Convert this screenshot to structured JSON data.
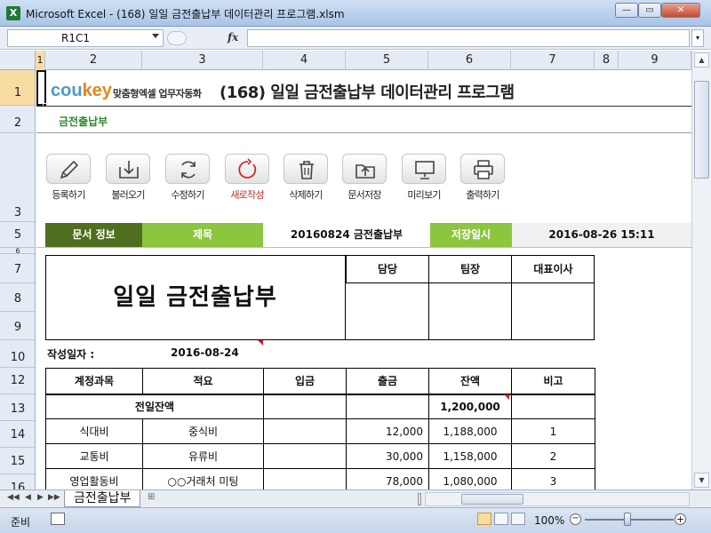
{
  "window": {
    "title": "Microsoft Excel - (168) 일일 금전출납부 데이터관리 프로그램.xlsm",
    "icon": "excel-icon",
    "min_label": "—",
    "max_label": "▭",
    "close_label": "✕"
  },
  "formula_bar": {
    "name_box": "R1C1",
    "fx_label": "fx",
    "formula": ""
  },
  "columns": [
    "1",
    "2",
    "3",
    "4",
    "5",
    "6",
    "7",
    "8",
    "9"
  ],
  "rows": [
    "1",
    "2",
    "3",
    "5",
    "6",
    "7",
    "8",
    "9",
    "10",
    "12",
    "13",
    "14",
    "15",
    "16"
  ],
  "header": {
    "logo_cou": "cou",
    "logo_key": "key",
    "logo_tagline": "맞춤형엑셀 업무자동화",
    "app_title": "(168) 일일 금전출납부 데이터관리 프로그램",
    "subtitle": "금전출납부"
  },
  "toolbar": [
    {
      "id": "register",
      "label": "등록하기",
      "icon": "pencil-icon"
    },
    {
      "id": "load",
      "label": "불러오기",
      "icon": "download-tray-icon"
    },
    {
      "id": "edit",
      "label": "수정하기",
      "icon": "refresh-icon"
    },
    {
      "id": "new",
      "label": "새로작성",
      "icon": "new-circle-icon",
      "accent": "#d12a2a"
    },
    {
      "id": "delete",
      "label": "삭제하기",
      "icon": "trash-icon"
    },
    {
      "id": "save",
      "label": "문서저장",
      "icon": "upload-folder-icon"
    },
    {
      "id": "preview",
      "label": "미리보기",
      "icon": "monitor-icon"
    },
    {
      "id": "print",
      "label": "출력하기",
      "icon": "printer-icon"
    }
  ],
  "info_bar": {
    "doc_info_label": "문서 정보",
    "title_label": "제목",
    "title_value": "20160824 금전출납부",
    "saved_label": "저장일시",
    "saved_value": "2016-08-26 15:11"
  },
  "document": {
    "title": "일일 금전출납부",
    "sign_headers": [
      "담당",
      "팀장",
      "대표이사"
    ],
    "date_label": "작성일자 :",
    "date_value": "2016-08-24"
  },
  "ledger": {
    "headers": [
      "계정과목",
      "적요",
      "입금",
      "출금",
      "잔액",
      "비고"
    ],
    "carry_over": {
      "label": "전일잔액",
      "balance": "1,200,000"
    },
    "rows": [
      {
        "account": "식대비",
        "desc": "중식비",
        "deposit": "",
        "withdrawal": "12,000",
        "balance": "1,188,000",
        "note": "1"
      },
      {
        "account": "교통비",
        "desc": "유류비",
        "deposit": "",
        "withdrawal": "30,000",
        "balance": "1,158,000",
        "note": "2"
      },
      {
        "account": "영업활동비",
        "desc": "○○거래처 미팅",
        "deposit": "",
        "withdrawal": "78,000",
        "balance": "1,080,000",
        "note": "3"
      }
    ]
  },
  "sheet_tabs": {
    "active": "금전출납부",
    "nav": [
      "◀◀",
      "◀",
      "▶",
      "▶▶"
    ]
  },
  "status_bar": {
    "status": "준비",
    "zoom": "100%",
    "zoom_minus": "−",
    "zoom_plus": "+"
  },
  "colors": {
    "info_dark_green": "#4f6f1e",
    "info_light_green": "#8cc63f",
    "subtitle_green": "#2c8a2c",
    "logo_blue": "#4b9bd0",
    "logo_orange": "#e8851a",
    "new_red": "#d12a2a"
  }
}
